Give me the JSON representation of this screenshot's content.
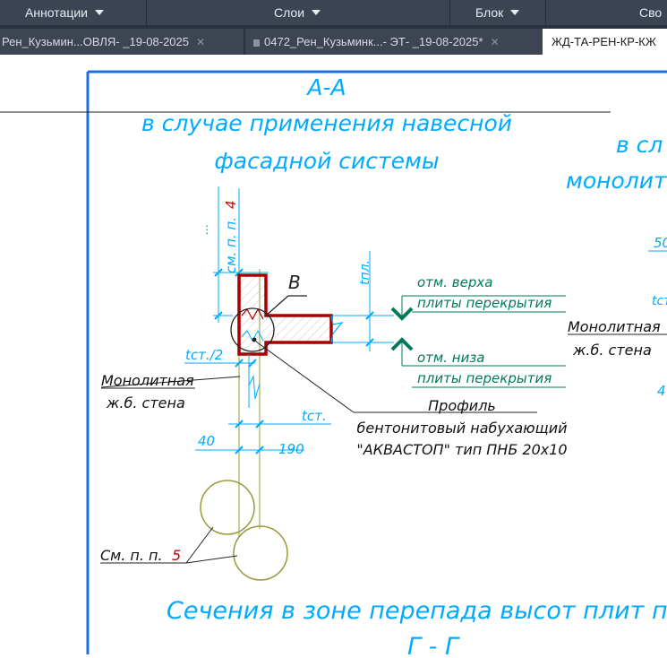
{
  "ribbon": {
    "panels": [
      {
        "label": "Аннотации"
      },
      {
        "label": "Слои"
      },
      {
        "label": "Блок"
      },
      {
        "label": "Сво"
      }
    ]
  },
  "tabs": [
    {
      "label": "Рен_Кузьмин...ОВЛЯ- _19-08-2025",
      "close": "✕",
      "locked": false,
      "active": false
    },
    {
      "label": "0472_Рен_Кузьминк...- ЭТ- _19-08-2025*",
      "close": "✕",
      "locked": true,
      "active": false
    },
    {
      "label": "ЖД-ТА-РЕН-КР-КЖ",
      "close": "",
      "locked": false,
      "active": true
    }
  ],
  "drawing": {
    "section_title": "А-А",
    "subtitle_line1": "в случае применения навесной",
    "subtitle_line2": "фасадной системы",
    "right_title_line1": "в сл",
    "right_title_line2": "монолит",
    "ref_top_prefix": "см. п. п.",
    "ref_top_num": "4",
    "ref_top_dots": "...",
    "label_v": "В",
    "label_tpl": "tпл.",
    "mark_top_line1": "отм. верха",
    "mark_top_line2": "плиты перекрытия",
    "mark_bottom_line1": "отм. низа",
    "mark_bottom_line2": "плиты перекрытия",
    "label_tst_half": "tст./2",
    "wall_label_line1": "Монолитная",
    "wall_label_line2": "ж.б. стена",
    "profile_line1": "Профиль",
    "profile_line2": "бентонитовый набухающий",
    "profile_line3": "\"АКВАСТОП\" тип ПНБ 20х10",
    "label_tst": "tст.",
    "dim_40": "40",
    "dim_190": "190",
    "ref_bottom_prefix": "См. п. п.",
    "ref_bottom_num": "5",
    "right_wall_line1": "Монолитная",
    "right_wall_line2": "ж.б. стена",
    "right_dim_50": "50",
    "right_dim_tst": "tст",
    "right_dim_4": "4",
    "bottom_title": "Сечения в зоне перепада высот плит п",
    "bottom_section": "Г - Г",
    "colors": {
      "cyan": "#00aaff",
      "green": "#007a5a",
      "red": "#a80000",
      "olive": "#9a9a3a",
      "frame": "#1e6fdc"
    }
  }
}
